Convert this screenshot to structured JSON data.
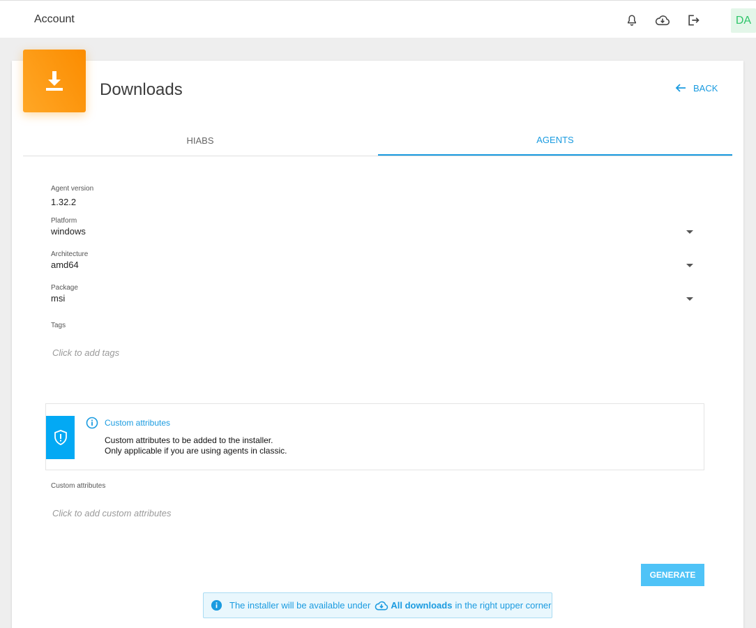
{
  "header": {
    "title": "Account",
    "icons": [
      "bell-icon",
      "cloud-download-icon",
      "logout-icon"
    ],
    "avatar": "DA"
  },
  "page": {
    "title": "Downloads",
    "back_label": "BACK"
  },
  "tabs": [
    {
      "label": "HIABS",
      "active": false
    },
    {
      "label": "AGENTS",
      "active": true
    }
  ],
  "form": {
    "agent_version": {
      "label": "Agent version",
      "value": "1.32.2"
    },
    "platform": {
      "label": "Platform",
      "value": "windows"
    },
    "architecture": {
      "label": "Architecture",
      "value": "amd64"
    },
    "package": {
      "label": "Package",
      "value": "msi"
    },
    "tags": {
      "label": "Tags",
      "placeholder": "Click to add tags"
    },
    "custom_attributes": {
      "label": "Custom attributes",
      "placeholder": "Click to add custom attributes"
    }
  },
  "info_box": {
    "title": "Custom attributes",
    "line1": "Custom attributes to be added to the installer.",
    "line2": "Only applicable if you are using agents in classic."
  },
  "generate_label": "GENERATE",
  "notice": {
    "prefix": "The installer will be available under",
    "bold": "All downloads",
    "suffix": "in the right upper corner"
  },
  "colors": {
    "accent": "#1a9be0",
    "badge": "#fb8c00",
    "button": "#4fc3f7",
    "avatar_bg": "#e3f6e9",
    "avatar_text": "#2ec56a"
  }
}
